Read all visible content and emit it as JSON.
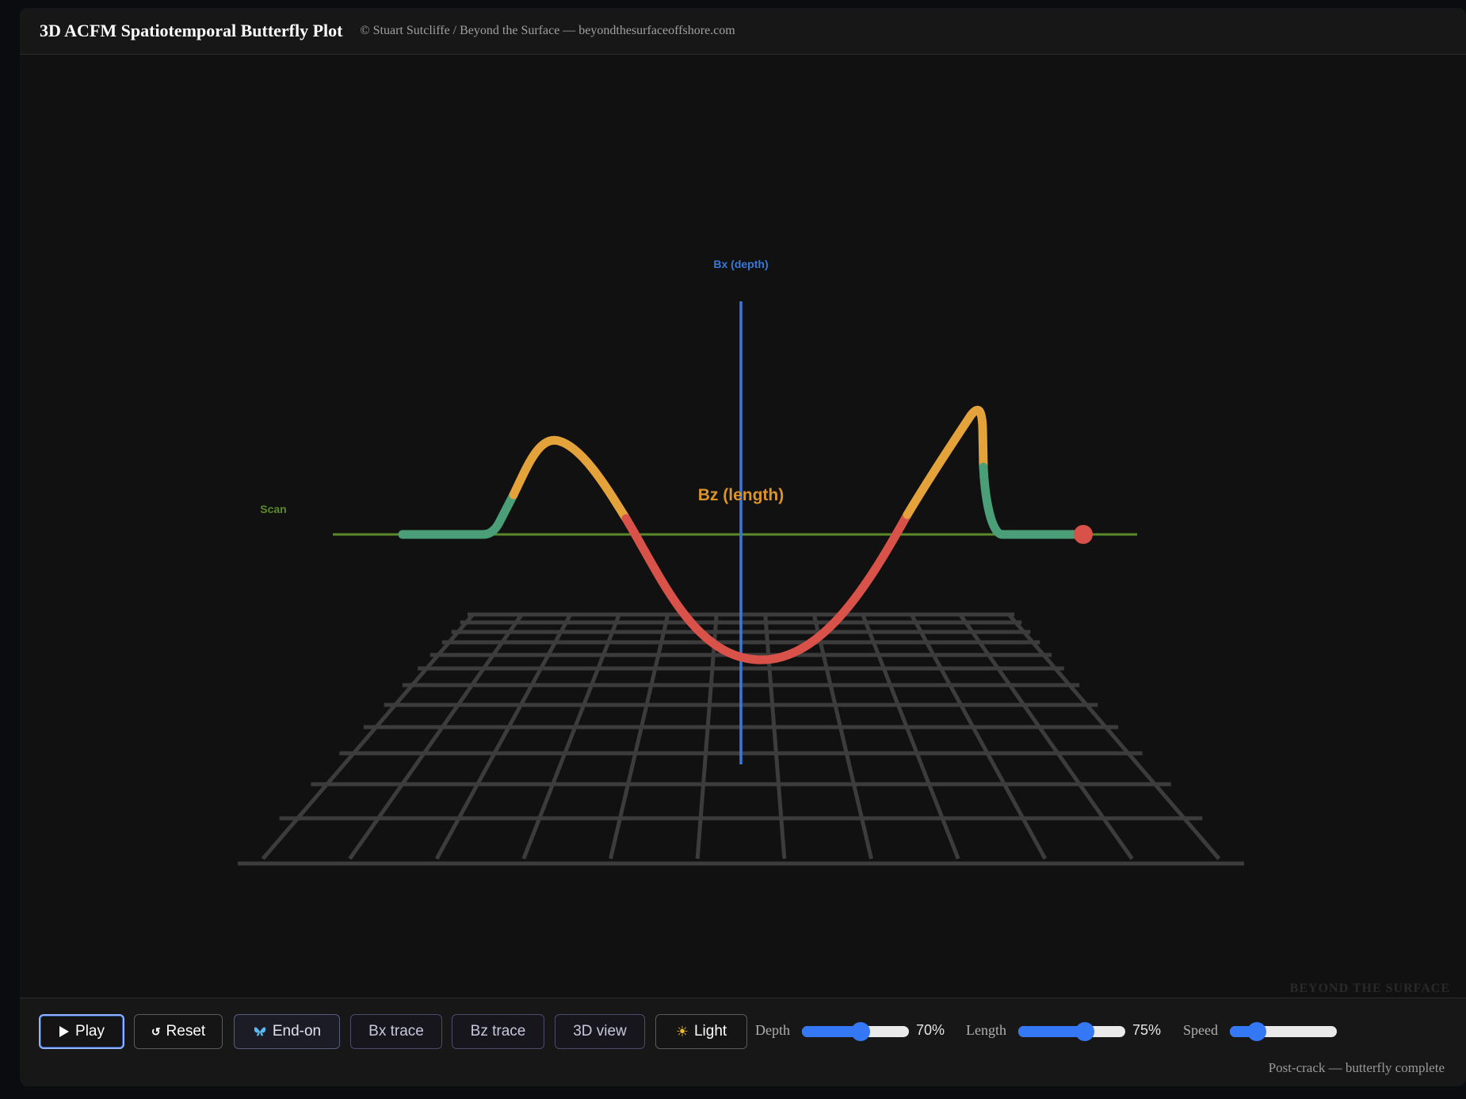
{
  "header": {
    "title": "3D ACFM Spatiotemporal Butterfly Plot",
    "credit": "© Stuart Sutcliffe / Beyond the Surface — beyondthesurfaceoffshore.com"
  },
  "plot": {
    "axis_bx_label": "Bx (depth)",
    "axis_bz_label": "Bz (length)",
    "axis_scan_label": "Scan",
    "watermark": "BEYOND THE SURFACE",
    "colors": {
      "bx_axis": "#3a78d8",
      "scan_axis": "#5a8a2a",
      "bz_label": "#d9942a",
      "trace_green": "#4a9e78",
      "trace_orange": "#e3a23a",
      "trace_red": "#d9524a",
      "grid": "#3c3c3c"
    }
  },
  "toolbar": {
    "play_label": "Play",
    "play_icon": "play-icon",
    "reset_label": "Reset",
    "reset_icon": "reset-icon",
    "endon_label": "End-on",
    "endon_icon": "butterfly-icon",
    "bx_trace_label": "Bx trace",
    "bz_trace_label": "Bz trace",
    "view3d_label": "3D view",
    "light_label": "Light",
    "light_icon": "sun-icon",
    "depth_label": "Depth",
    "depth_value": "70%",
    "depth_fraction": 0.55,
    "length_label": "Length",
    "length_value": "75%",
    "length_fraction": 0.62,
    "speed_label": "Speed",
    "speed_fraction": 0.25
  },
  "status": {
    "text": "Post-crack — butterfly complete"
  }
}
